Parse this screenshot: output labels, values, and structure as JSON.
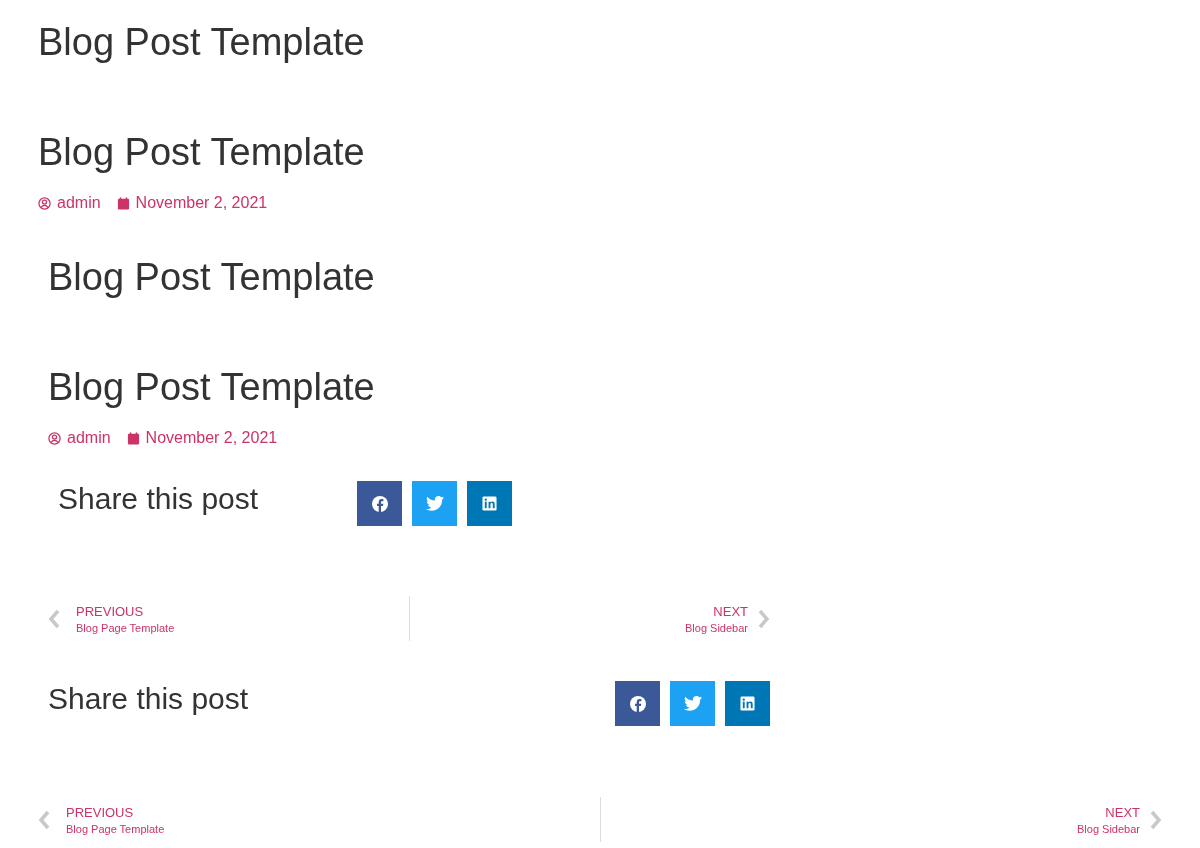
{
  "sections": [
    {
      "blocks": [
        {
          "kind": "heading",
          "text": "Blog Post Template"
        },
        {
          "kind": "heading",
          "text": "Blog Post Template"
        },
        {
          "kind": "meta",
          "author": "admin",
          "date": "November 2, 2021"
        }
      ]
    },
    {
      "blocks": [
        {
          "kind": "heading",
          "text": "Blog Post Template"
        },
        {
          "kind": "heading",
          "text": "Blog Post Template"
        },
        {
          "kind": "meta",
          "author": "admin",
          "date": "November 2, 2021"
        },
        {
          "kind": "share",
          "title": "Share this post",
          "networks": [
            {
              "kind": "facebook"
            },
            {
              "kind": "twitter"
            },
            {
              "kind": "linkedin"
            }
          ]
        },
        {
          "kind": "postnav",
          "prev_label": "PREVIOUS",
          "prev_title": "Blog Page Template",
          "next_label": "NEXT",
          "next_title": "Blog Sidebar"
        },
        {
          "kind": "share",
          "title": "Share this post",
          "networks": [
            {
              "kind": "facebook"
            },
            {
              "kind": "twitter"
            },
            {
              "kind": "linkedin"
            }
          ]
        }
      ]
    },
    {
      "blocks": [
        {
          "kind": "postnav",
          "prev_label": "PREVIOUS",
          "prev_title": "Blog Page Template",
          "next_label": "NEXT",
          "next_title": "Blog Sidebar"
        }
      ]
    }
  ]
}
